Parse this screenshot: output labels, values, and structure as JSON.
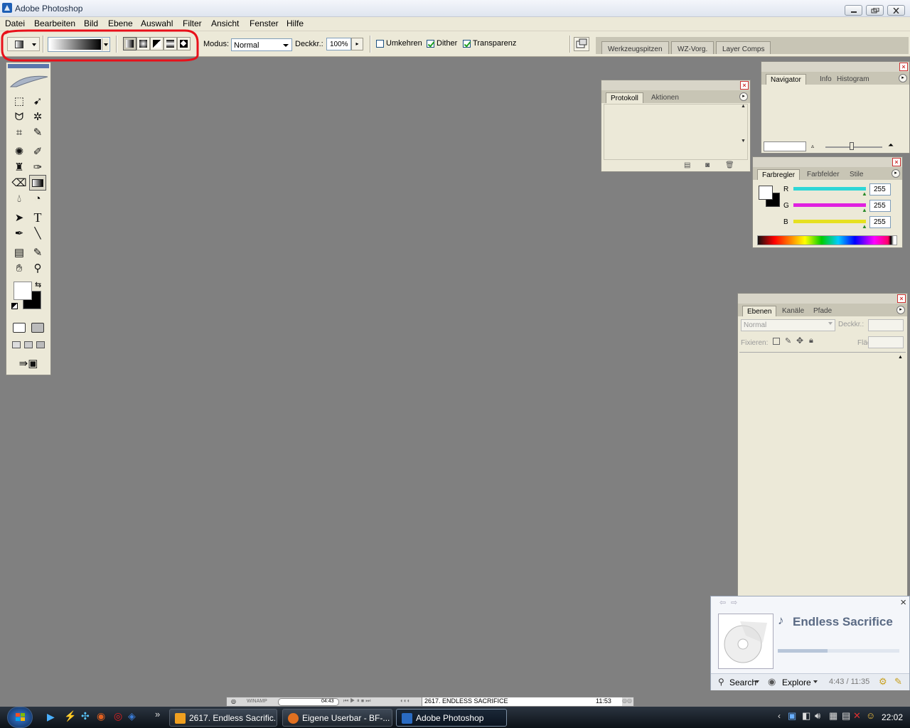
{
  "window": {
    "title": "Adobe Photoshop"
  },
  "menu": [
    "Datei",
    "Bearbeiten",
    "Bild",
    "Ebene",
    "Auswahl",
    "Filter",
    "Ansicht",
    "Fenster",
    "Hilfe"
  ],
  "options": {
    "modus_label": "Modus:",
    "modus_value": "Normal",
    "deckkraft_label": "Deckkr.:",
    "deckkraft_value": "100%",
    "umkehren_label": "Umkehren",
    "umkehren_checked": false,
    "dither_label": "Dither",
    "dither_checked": true,
    "transparenz_label": "Transparenz",
    "transparenz_checked": true,
    "highlight_color": "#e8101a"
  },
  "palette_well": [
    "Werkzeugspitzen",
    "WZ-Vorg.",
    "Layer Comps"
  ],
  "panels": {
    "protokoll": {
      "tabs": [
        "Protokoll",
        "Aktionen"
      ]
    },
    "navigator": {
      "tabs": [
        "Navigator",
        "Info",
        "Histogram"
      ]
    },
    "farbregler": {
      "tabs": [
        "Farbregler",
        "Farbfelder",
        "Stile"
      ],
      "channels": [
        {
          "label": "R",
          "value": "255",
          "color": "#2fd6d6"
        },
        {
          "label": "G",
          "value": "255",
          "color": "#e020e0"
        },
        {
          "label": "B",
          "value": "255",
          "color": "#e6e020"
        }
      ]
    },
    "ebenen": {
      "tabs": [
        "Ebenen",
        "Kanäle",
        "Pfade"
      ],
      "mode_placeholder": "Normal",
      "deckkr_label": "Deckkr.:",
      "fixieren_label": "Fixieren:",
      "flaeche_label": "Fläche:"
    }
  },
  "winamp": {
    "brand": "WINAMP",
    "time": "04:43",
    "track": "2617. ENDLESS SACRIFICE",
    "duration": "11:53"
  },
  "popup": {
    "song": "Endless Sacrifice",
    "search": "Search",
    "explore": "Explore",
    "time": "4:43 / 11:35",
    "progress": 0.41
  },
  "taskbar": {
    "buttons": [
      {
        "label": "2617. Endless Sacrific...",
        "icon": "winamp-icon",
        "color": "#f0a020"
      },
      {
        "label": "Eigene Userbar - BF-...",
        "icon": "firefox-icon",
        "color": "#e07020"
      },
      {
        "label": "Adobe Photoshop",
        "icon": "photoshop-icon",
        "color": "#2a6bc2"
      }
    ],
    "clock": "22:02"
  }
}
